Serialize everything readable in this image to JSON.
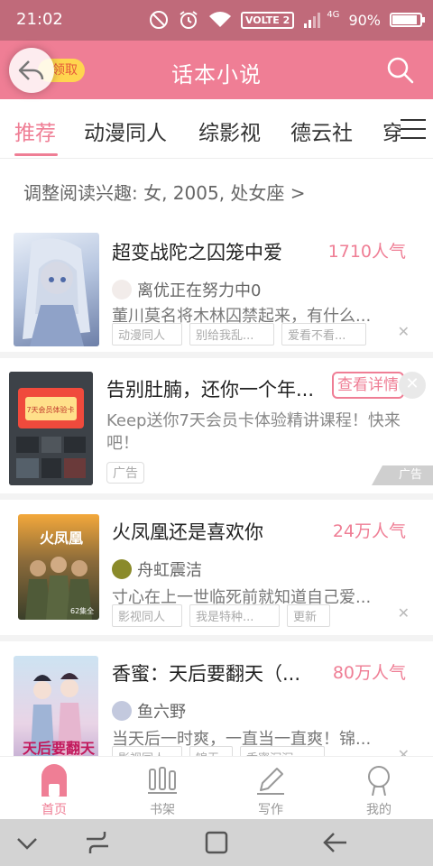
{
  "status_bar": {
    "time": "21:02",
    "volte": "VOLTE 2",
    "network": "4G",
    "battery": "90%",
    "battery_level": 0.9
  },
  "header": {
    "title": "话本小说",
    "claim_label": "领取"
  },
  "tabs": [
    {
      "label": "推荐",
      "active": true
    },
    {
      "label": "动漫同人"
    },
    {
      "label": "综影视"
    },
    {
      "label": "德云社"
    },
    {
      "label": "穿"
    }
  ],
  "preference": {
    "text": "调整阅读兴趣: 女, 2005, 处女座 >"
  },
  "books": [
    {
      "title": "超变战陀之囚笼中爱",
      "popularity": "1710人气",
      "author": "离优正在努力中0",
      "desc": "董川莫名将木林囚禁起来，有什么...",
      "tags": [
        "动漫同人",
        "别给我乱...",
        "爱看不看..."
      ]
    },
    {
      "title": "火凤凰还是喜欢你",
      "popularity": "24万人气",
      "author": "舟虹震洁",
      "desc": "寸心在上一世临死前就知道自己爱...",
      "tags": [
        "影视同人",
        "我是特种...",
        "更新"
      ],
      "cover_text": "火凤凰",
      "cover_sub": "62集全"
    },
    {
      "title": "香蜜：天后要翻天（...",
      "popularity": "80万人气",
      "author": "鱼六野",
      "desc": "当天后一时爽，一直当一直爽！锦...",
      "tags": [
        "影视同人",
        "锦无",
        "香蜜沉沉..."
      ],
      "cover_text": "天后要翻天"
    }
  ],
  "ad": {
    "title": "告别肚腩，还你一个年...",
    "detail_label": "查看详情",
    "desc": "Keep送你7天会员卡体验精讲课程！快来吧！",
    "badge": "广告",
    "mark": "广告",
    "cover_text": "7天会员体验卡"
  },
  "bottom_nav": [
    {
      "label": "首页",
      "active": true
    },
    {
      "label": "书架"
    },
    {
      "label": "写作"
    },
    {
      "label": "我的"
    }
  ],
  "colors": {
    "accent": "#ef7e95",
    "status_bar": "#c06a7a"
  }
}
